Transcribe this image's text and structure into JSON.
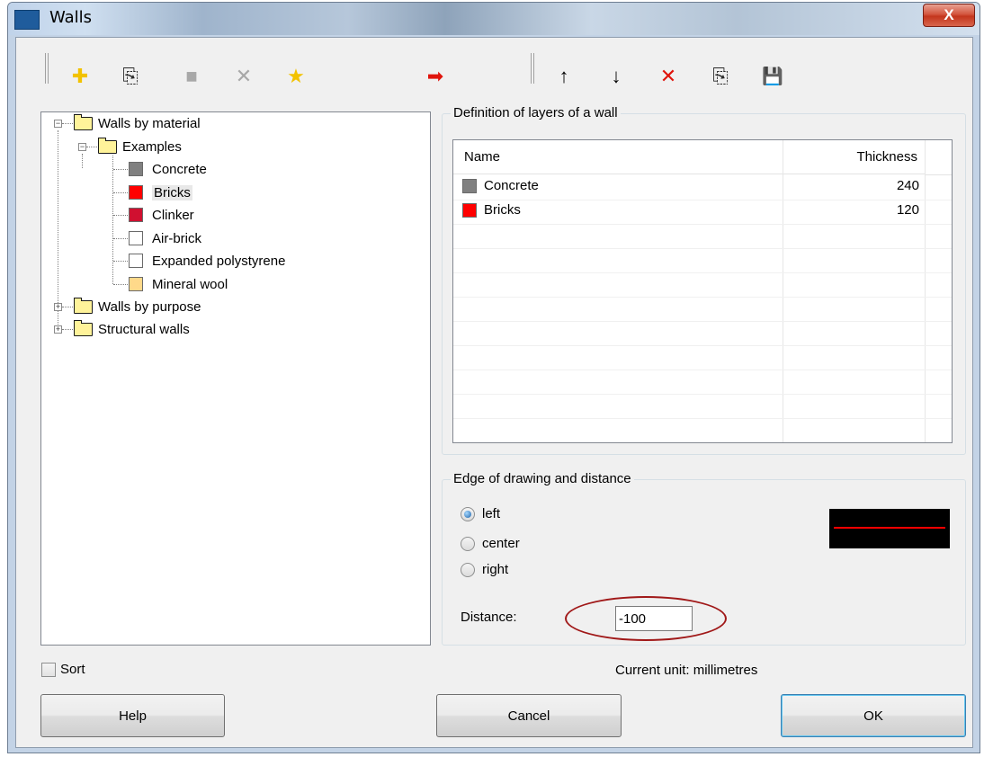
{
  "window": {
    "title": "Walls",
    "close_glyph": "X"
  },
  "toolbar": {
    "left": [
      {
        "name": "add-icon",
        "glyph": "✚",
        "color": "#f2c200"
      },
      {
        "name": "copy-icon",
        "glyph": "⎘",
        "color": "#2a2a2a"
      },
      {
        "name": "square-icon",
        "glyph": "■",
        "color": "#a8a8a8"
      },
      {
        "name": "delete-disabled-icon",
        "glyph": "✕",
        "color": "#a8a8a8"
      },
      {
        "name": "star-icon",
        "glyph": "★",
        "color": "#f2c200"
      }
    ],
    "transfer_icon": {
      "name": "arrow-right-icon",
      "glyph": "➡",
      "color": "#e0140c"
    },
    "right": [
      {
        "name": "arrow-up-icon",
        "glyph": "↑",
        "color": "#000000"
      },
      {
        "name": "arrow-down-icon",
        "glyph": "↓",
        "color": "#000000"
      },
      {
        "name": "delete-icon",
        "glyph": "✕",
        "color": "#e0140c"
      },
      {
        "name": "copy-icon",
        "glyph": "⎘",
        "color": "#2a2a2a"
      },
      {
        "name": "save-icon",
        "glyph": "💾",
        "color": "#000000"
      }
    ]
  },
  "tree": {
    "root1": "Walls by material",
    "examples": "Examples",
    "materials": [
      {
        "label": "Concrete",
        "color": "#808080"
      },
      {
        "label": "Bricks",
        "color": "#ff0000"
      },
      {
        "label": "Clinker",
        "color": "#d01030"
      },
      {
        "label": "Air-brick",
        "color": "#ffffff"
      },
      {
        "label": "Expanded polystyrene",
        "color": "#ffffff"
      },
      {
        "label": "Mineral wool",
        "color": "#ffd98a"
      }
    ],
    "root2": "Walls by purpose",
    "root3": "Structural walls",
    "collapse_glyph": "−",
    "expand_glyph": "+"
  },
  "layers_group": {
    "legend": "Definition of layers of a wall",
    "columns": {
      "name": "Name",
      "thickness": "Thickness"
    },
    "rows": [
      {
        "name": "Concrete",
        "thickness": "240",
        "color": "#808080"
      },
      {
        "name": "Bricks",
        "thickness": "120",
        "color": "#ff0000"
      }
    ]
  },
  "edge_group": {
    "legend": "Edge of drawing and distance",
    "options": [
      "left",
      "center",
      "right"
    ],
    "selected": "left",
    "distance_label": "Distance:",
    "distance_value": "-100"
  },
  "sort_label": "Sort",
  "unit_text": "Current unit: millimetres",
  "buttons": {
    "help": "Help",
    "cancel": "Cancel",
    "ok": "OK"
  }
}
